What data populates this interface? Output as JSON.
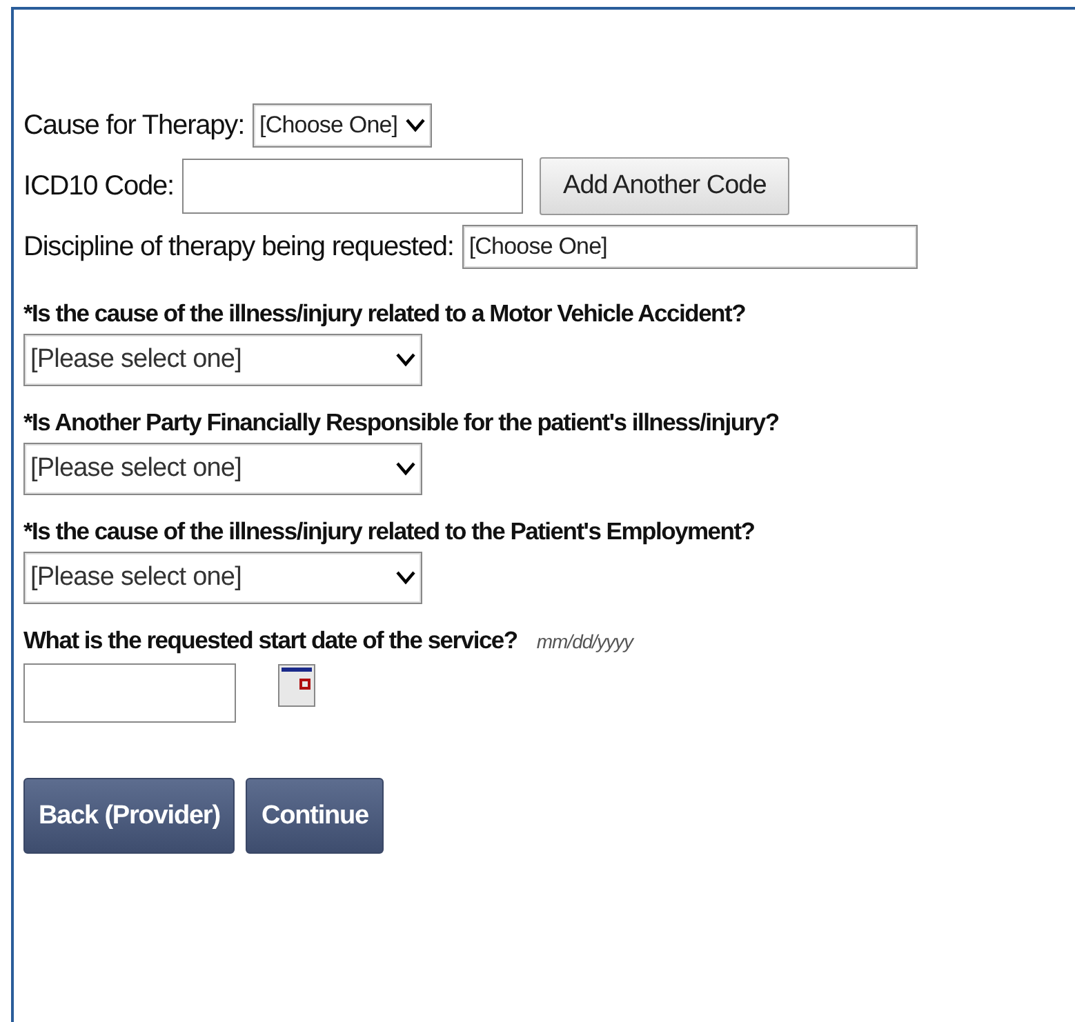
{
  "cause": {
    "label": "Cause for Therapy:",
    "select": "[Choose One]"
  },
  "icd": {
    "label": "ICD10 Code:",
    "button": "Add Another Code"
  },
  "discipline": {
    "label": "Discipline of therapy being requested:",
    "select": "[Choose One]"
  },
  "questions": [
    {
      "label": "*Is the cause of the illness/injury related to a Motor Vehicle Accident?",
      "select": "[Please select one]"
    },
    {
      "label": "*Is Another Party Financially Responsible for the patient's illness/injury?",
      "select": "[Please select one]"
    },
    {
      "label": "*Is the cause of the illness/injury related to the Patient's Employment?",
      "select": "[Please select one]"
    }
  ],
  "start_date": {
    "label": "What is the requested start date of the service?",
    "hint": "mm/dd/yyyy"
  },
  "buttons": [
    "Back (Provider)",
    "Continue"
  ]
}
